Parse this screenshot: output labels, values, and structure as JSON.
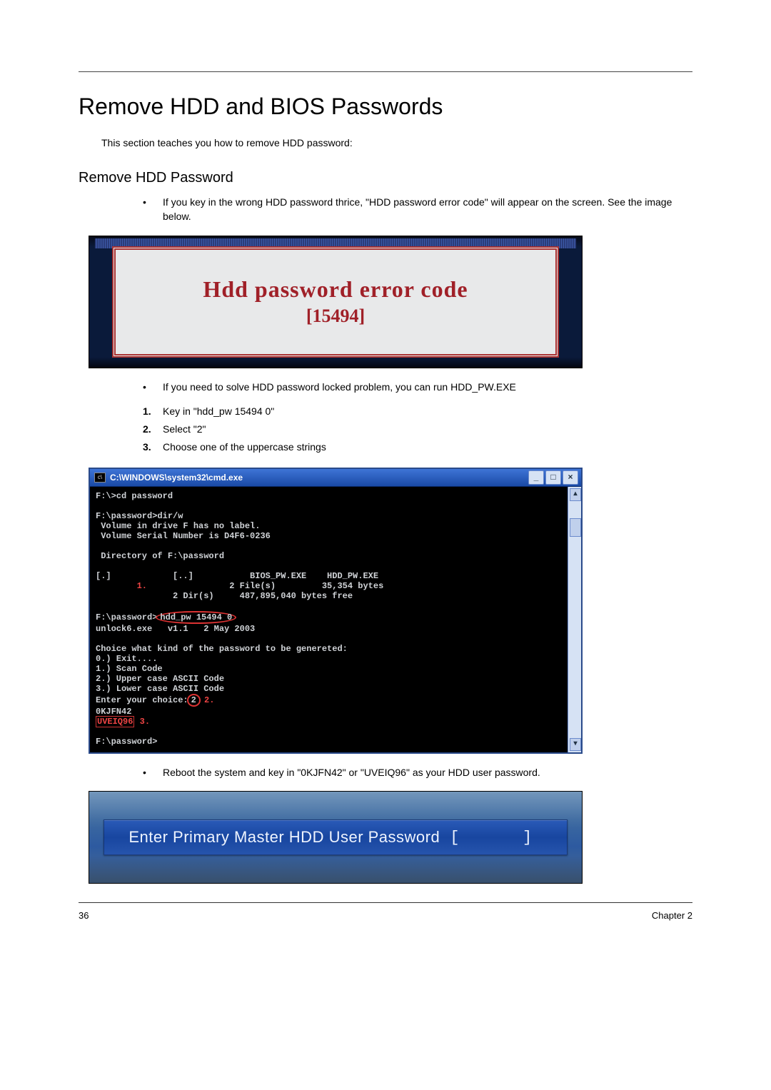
{
  "page": {
    "number": "36",
    "chapter": "Chapter 2",
    "title": "Remove HDD and BIOS Passwords",
    "intro": "This section teaches you how to remove HDD password:",
    "subtitle": "Remove HDD Password"
  },
  "bul1": "If you key in the wrong HDD password thrice, \"HDD password error code\" will appear on the screen. See the image below.",
  "panel1": {
    "line": "Hdd password error code",
    "code": "[15494]"
  },
  "bul2": "If you need to solve HDD password locked problem, you can run HDD_PW.EXE",
  "step1": "Key in \"hdd_pw 15494 0\"",
  "step2": "Select \"2\"",
  "step3": "Choose one of the uppercase strings",
  "cmd": {
    "title": "C:\\WINDOWS\\system32\\cmd.exe",
    "line1": "F:\\>cd password",
    "line2": "F:\\password>dir/w",
    "line3": " Volume in drive F has no label.",
    "line4": " Volume Serial Number is D4F6-0236",
    "line5": " Directory of F:\\password",
    "line6": "[.]            [..]           BIOS_PW.EXE    HDD_PW.EXE",
    "line7": "               2 File(s)         35,354 bytes",
    "line8": "               2 Dir(s)     487,895,040 bytes free",
    "line9a": "F:\\password>",
    "line9b": "hdd_pw 15494 0",
    "line10": "unlock6.exe   v1.1   2 May 2003",
    "line11": "Choice what kind of the password to be genereted:",
    "line12": "0.) Exit....",
    "line13": "1.) Scan Code",
    "line14": "2.) Upper case ASCII Code",
    "line15": "3.) Lower case ASCII Code",
    "line16a": "Enter your choice:",
    "line16b": "2",
    "line17": "0KJFN42",
    "line18": "UVEIQ96",
    "line19": "F:\\password>",
    "ann1": "1.",
    "ann2": "2.",
    "ann3": "3."
  },
  "bul3": "Reboot the system and key in \"0KJFN42\" or \"UVEIQ96\" as your HDD user password.",
  "panel3": {
    "text": "Enter Primary Master HDD User Password",
    "lb": "[",
    "rb": "]"
  }
}
